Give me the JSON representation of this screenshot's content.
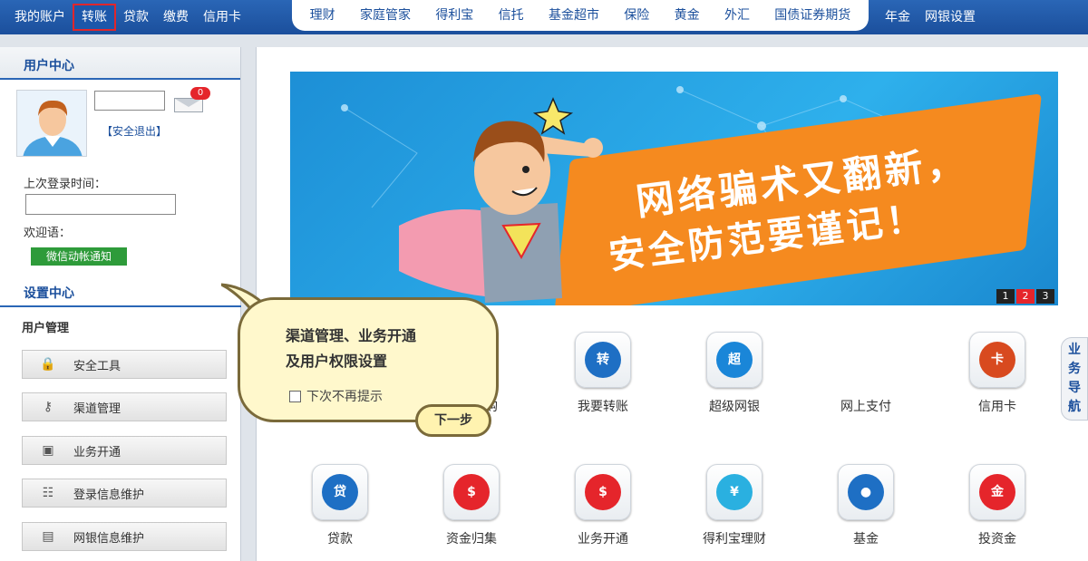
{
  "nav": {
    "left": [
      "我的账户",
      "转账",
      "贷款",
      "缴费",
      "信用卡"
    ],
    "middle": [
      "理财",
      "家庭管家",
      "得利宝",
      "信托",
      "基金超市",
      "保险",
      "黄金",
      "外汇",
      "国债证券期货"
    ],
    "right": [
      "年金",
      "网银设置"
    ]
  },
  "sidebar": {
    "user_center": "用户中心",
    "mail_count": "0",
    "logout": "【安全退出】",
    "last_login_label": "上次登录时间：",
    "welcome_label": "欢迎语：",
    "wechat_button": "微信动帐通知",
    "settings_center": "设置中心",
    "user_mgmt": "用户管理",
    "items": [
      {
        "label": "安全工具",
        "icon": "lock-icon"
      },
      {
        "label": "渠道管理",
        "icon": "key-icon"
      },
      {
        "label": "业务开通",
        "icon": "briefcase-icon"
      },
      {
        "label": "登录信息维护",
        "icon": "user-card-icon"
      },
      {
        "label": "网银信息维护",
        "icon": "id-card-icon"
      }
    ]
  },
  "banner": {
    "line1": "网络骗术又翻新，",
    "line2": "安全防范要谨记！",
    "pages": [
      "1",
      "2",
      "3"
    ]
  },
  "tiles": [
    {
      "label": "购",
      "icon": "shopping-icon",
      "color": "#2a7fd4"
    },
    {
      "label": "我要转账",
      "icon": "transfer-icon",
      "color": "#1e6fc4"
    },
    {
      "label": "超级网银",
      "icon": "super-ebank-icon",
      "color": "#1a86d8"
    },
    {
      "label": "网上支付",
      "icon": "online-pay-icon",
      "color": "#3a9de0"
    },
    {
      "label": "信用卡",
      "icon": "credit-card-icon",
      "color": "#d84a1f"
    },
    {
      "label": "贷款",
      "icon": "loan-icon",
      "color": "#1e6fc4"
    },
    {
      "label": "资金归集",
      "icon": "fund-collect-icon",
      "color": "#e5252b"
    },
    {
      "label": "业务开通",
      "icon": "business-open-icon",
      "color": "#e5252b"
    },
    {
      "label": "得利宝理财",
      "icon": "delibao-icon",
      "color": "#2ab0e0"
    },
    {
      "label": "基金",
      "icon": "fund-icon",
      "color": "#1e6fc4"
    },
    {
      "label": "投资金",
      "icon": "gold-invest-icon",
      "color": "#e5252b"
    }
  ],
  "sidenav": "业务导航",
  "tooltip": {
    "line1": "渠道管理、业务开通",
    "line2": "及用户权限设置",
    "checkbox": "下次不再提示",
    "next": "下一步"
  }
}
